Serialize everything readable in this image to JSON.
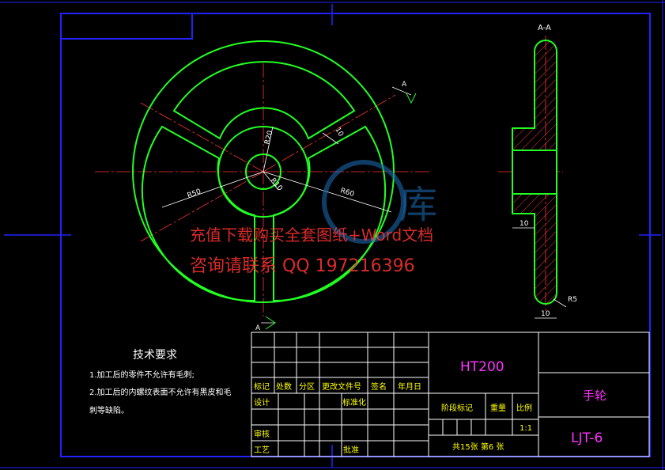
{
  "section_label": "A-A",
  "cut_marks": {
    "top": "A",
    "bottom": "A"
  },
  "dimensions": {
    "r20": "R20",
    "r10": "R10",
    "r50": "R50",
    "r60": "R60",
    "spoke_width": "10",
    "hub_width": "10",
    "rim_width": "10",
    "rim_radius": "R5"
  },
  "watermark": {
    "line1": "充值下载购买全套图纸+Word文档",
    "line2": "咨询请联系  QQ 197216396",
    "logo_char": "库"
  },
  "tech_requirements": {
    "title": "技术要求",
    "item1": "1.加工后的零件不允许有毛刺;",
    "item2a": "2.加工后的内螺纹表面不允许有黑皮和毛",
    "item2b": "刺等缺陷。"
  },
  "title_block": {
    "material": "HT200",
    "part_name": "手轮",
    "drawing_number": "LJT-6",
    "col_mark": "标记",
    "col_count": "处数",
    "col_zone": "分区",
    "col_change_doc": "更改文件号",
    "col_signature": "签名",
    "col_date": "年月日",
    "row_design": "设计",
    "row_standard": "标准化",
    "row_review": "审核",
    "row_process": "工艺",
    "row_approve": "批准",
    "stage_mark": "阶段标记",
    "weight": "重量",
    "scale_label": "比例",
    "scale_value": "1:1",
    "sheet_info": "共15张  第6 张"
  }
}
